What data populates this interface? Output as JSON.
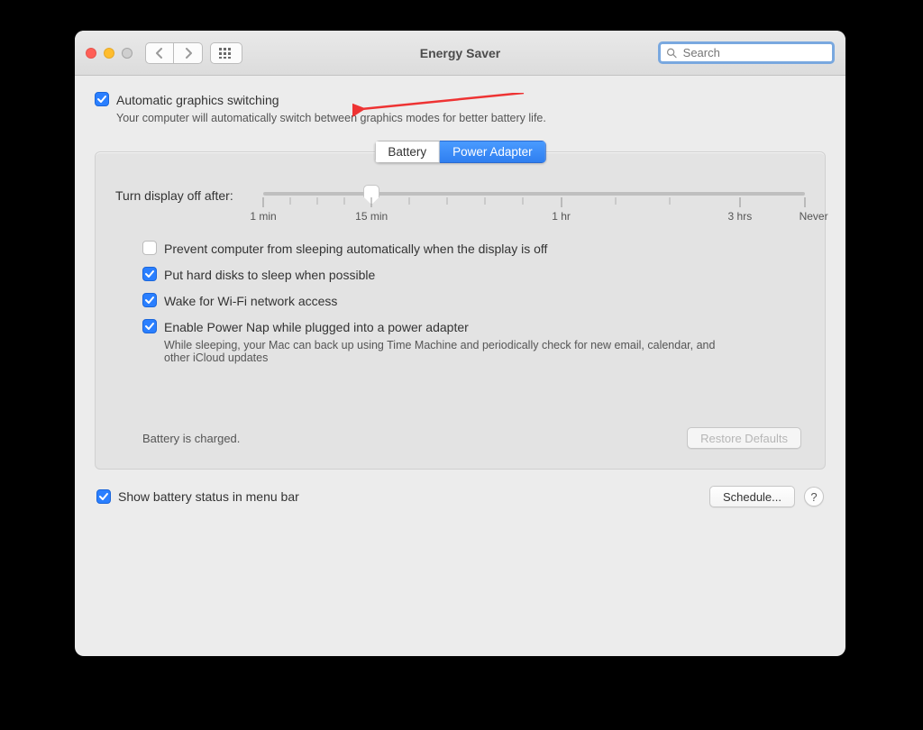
{
  "window": {
    "title": "Energy Saver"
  },
  "search": {
    "placeholder": "Search"
  },
  "auto_gfx": {
    "label": "Automatic graphics switching",
    "description": "Your computer will automatically switch between graphics modes for better battery life."
  },
  "tabs": {
    "battery": "Battery",
    "power_adapter": "Power Adapter"
  },
  "slider": {
    "label": "Turn display off after:",
    "ticks": [
      "1 min",
      "15 min",
      "1 hr",
      "3 hrs",
      "Never"
    ]
  },
  "options": {
    "prevent_sleep": "Prevent computer from sleeping automatically when the display is off",
    "hd_sleep": "Put hard disks to sleep when possible",
    "wake_wifi": "Wake for Wi-Fi network access",
    "power_nap": "Enable Power Nap while plugged into a power adapter",
    "power_nap_sub": "While sleeping, your Mac can back up using Time Machine and periodically check for new email, calendar, and other iCloud updates"
  },
  "status": "Battery is charged.",
  "restore_defaults": "Restore Defaults",
  "show_menu_bar": "Show battery status in menu bar",
  "schedule": "Schedule...",
  "help": "?"
}
